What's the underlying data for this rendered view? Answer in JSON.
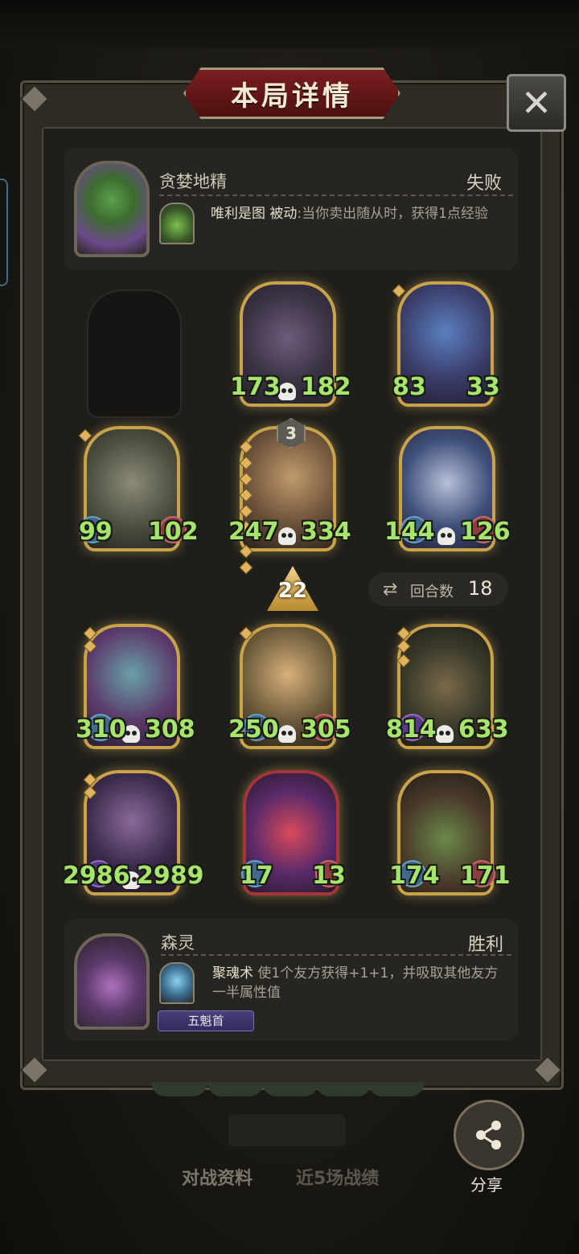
{
  "title": "本局详情",
  "close_icon": "close-x-icon",
  "top_player": {
    "name": "贪婪地精",
    "result": "失败",
    "skill_name": "唯利是图",
    "skill_type": "被动",
    "skill_text": ":当你卖出随从时，获得1点经验"
  },
  "board": {
    "level_badge": "3",
    "tier": "22",
    "round_label": "回合数",
    "round_value": "18",
    "round_icon": "swap-icon",
    "minions": [
      {
        "atk": "173",
        "hp": "182"
      },
      {
        "atk": "83",
        "hp": "33"
      },
      {
        "atk": "99",
        "hp": "102"
      },
      {
        "atk": "247",
        "hp": "334"
      },
      {
        "atk": "144",
        "hp": "126"
      },
      {
        "atk": "310",
        "hp": "308"
      },
      {
        "atk": "250",
        "hp": "305"
      },
      {
        "atk": "814",
        "hp": "633"
      },
      {
        "atk": "2986",
        "hp": "2989"
      },
      {
        "atk": "17",
        "hp": "13"
      },
      {
        "atk": "174",
        "hp": "171"
      }
    ]
  },
  "bottom_player": {
    "name": "森灵",
    "result": "胜利",
    "skill_name": "聚魂术",
    "skill_text": "使1个友方获得+1+1，并吸取其他友方一半属性值",
    "tag": "五魁首",
    "skill_badge": "11"
  },
  "tabs": [
    "对战资料",
    "近5场战绩"
  ],
  "share_label": "分享",
  "share_icon": "share-icon"
}
